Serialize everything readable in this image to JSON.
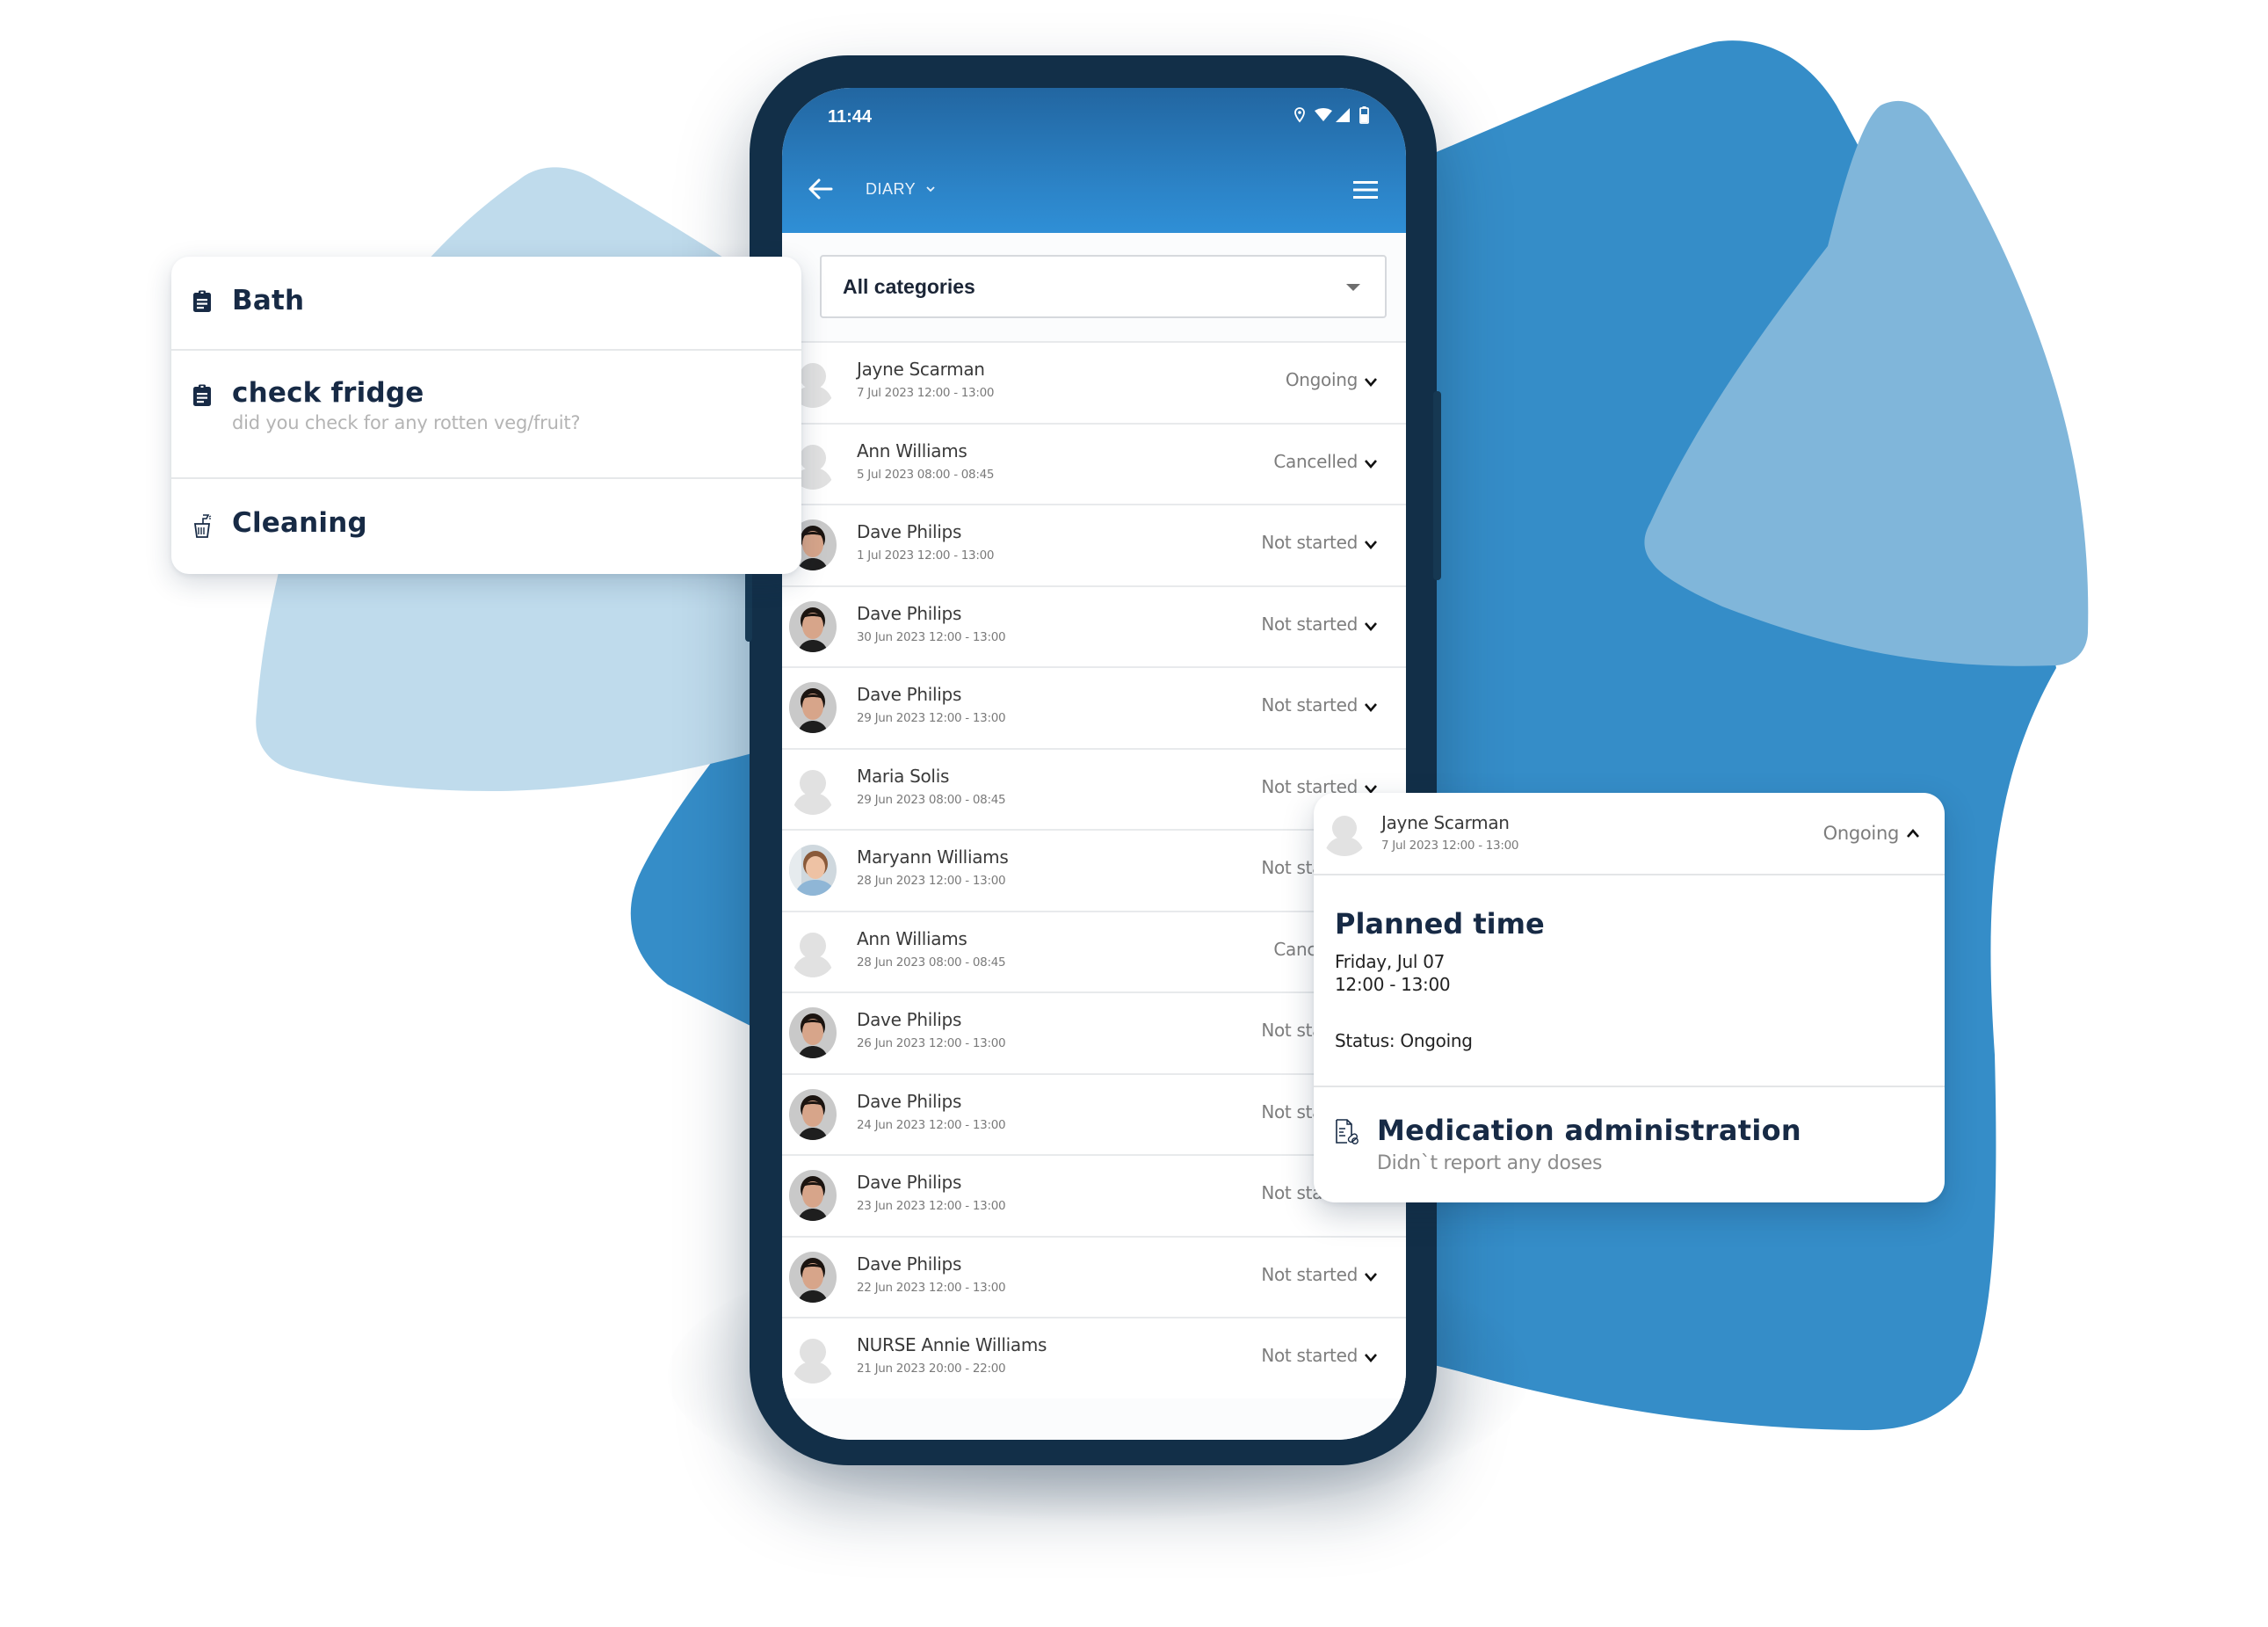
{
  "colors": {
    "brand_blue": "#358dc8",
    "light_blue_blob": "#bfdbec",
    "mid_blue_blob": "#80b6da",
    "phone_frame": "#122f48",
    "header_gradient_top": "#2266a1",
    "header_gradient_bottom": "#2f8fd6",
    "title_text": "#172a45"
  },
  "status_bar": {
    "time": "11:44",
    "icons": [
      "location-icon",
      "wifi-icon",
      "signal-icon",
      "battery-icon"
    ]
  },
  "app_bar": {
    "back_icon": "arrow-left-icon",
    "title": "DIARY",
    "title_dropdown_icon": "chevron-down-icon",
    "menu_icon": "hamburger-menu-icon"
  },
  "filter": {
    "selected": "All categories",
    "icon": "caret-down-icon"
  },
  "diary_list": [
    {
      "name": "Jayne Scarman",
      "datetime": "7 Jul 2023 12:00 - 13:00",
      "status": "Ongoing",
      "avatar": "placeholder"
    },
    {
      "name": "Ann Williams",
      "datetime": "5 Jul 2023 08:00 - 08:45",
      "status": "Cancelled",
      "avatar": "placeholder"
    },
    {
      "name": "Dave Philips",
      "datetime": "1 Jul 2023 12:00 - 13:00",
      "status": "Not started",
      "avatar": "photo-man"
    },
    {
      "name": "Dave Philips",
      "datetime": "30 Jun 2023 12:00 - 13:00",
      "status": "Not started",
      "avatar": "photo-man"
    },
    {
      "name": "Dave Philips",
      "datetime": "29 Jun 2023 12:00 - 13:00",
      "status": "Not started",
      "avatar": "photo-man"
    },
    {
      "name": "Maria Solis",
      "datetime": "29 Jun 2023 08:00 - 08:45",
      "status": "Not started",
      "avatar": "placeholder"
    },
    {
      "name": "Maryann Williams",
      "datetime": "28 Jun 2023 12:00 - 13:00",
      "status": "Not started",
      "avatar": "photo-woman"
    },
    {
      "name": "Ann Williams",
      "datetime": "28 Jun 2023 08:00 - 08:45",
      "status": "Cancelled",
      "avatar": "placeholder"
    },
    {
      "name": "Dave Philips",
      "datetime": "26 Jun 2023 12:00 - 13:00",
      "status": "Not started",
      "avatar": "photo-man"
    },
    {
      "name": "Dave Philips",
      "datetime": "24 Jun 2023 12:00 - 13:00",
      "status": "Not started",
      "avatar": "photo-man"
    },
    {
      "name": "Dave Philips",
      "datetime": "23 Jun 2023 12:00 - 13:00",
      "status": "Not started",
      "avatar": "photo-man"
    },
    {
      "name": "Dave Philips",
      "datetime": "22 Jun 2023 12:00 - 13:00",
      "status": "Not started",
      "avatar": "photo-man"
    },
    {
      "name": "NURSE Annie Williams",
      "datetime": "21 Jun 2023 20:00 - 22:00",
      "status": "Not started",
      "avatar": "placeholder"
    }
  ],
  "task_card": {
    "items": [
      {
        "title": "Bath",
        "subtitle": "",
        "icon": "clipboard-icon"
      },
      {
        "title": "check fridge",
        "subtitle": "did you check for any rotten veg/fruit?",
        "icon": "clipboard-icon"
      },
      {
        "title": "Cleaning",
        "subtitle": "",
        "icon": "cleaning-bucket-icon"
      }
    ]
  },
  "detail_card": {
    "name": "Jayne Scarman",
    "datetime": "7 Jul 2023 12:00 - 13:00",
    "status": "Ongoing",
    "collapse_icon": "chevron-up-icon",
    "planned_title": "Planned time",
    "planned_day": "Friday, Jul 07",
    "planned_time": "12:00 - 13:00",
    "status_line": "Status: Ongoing",
    "medication": {
      "icon": "medication-document-icon",
      "title": "Medication administration",
      "subtitle": "Didn`t report any doses"
    }
  }
}
